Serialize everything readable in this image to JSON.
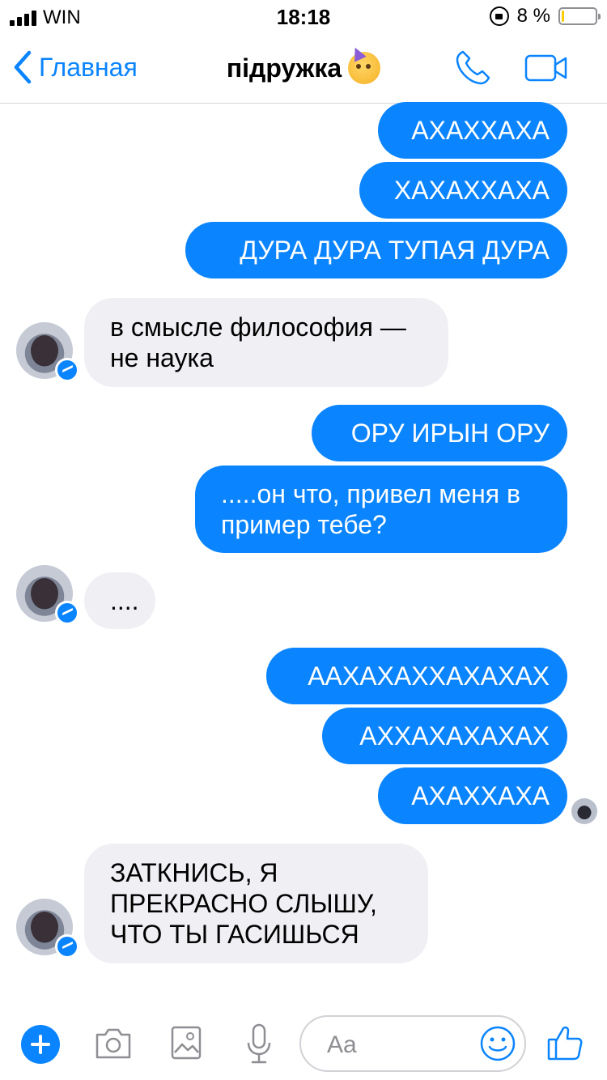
{
  "status_bar": {
    "carrier": "WIN",
    "time": "18:18",
    "battery_percent": "8 %",
    "battery_level": 0.08,
    "battery_color": "#ffcc00"
  },
  "nav": {
    "back_label": "Главная",
    "title": "підружка",
    "title_emoji": "partying-face-icon"
  },
  "messages": [
    {
      "side": "out",
      "text": "АХАХХАХА"
    },
    {
      "side": "out",
      "text": "ХАХАХХАХА"
    },
    {
      "side": "out",
      "text": "ДУРА ДУРА ТУПАЯ ДУРА"
    },
    {
      "side": "in",
      "text": "в смысле философия —\nне наука"
    },
    {
      "side": "out",
      "text": "ОРУ ИРЫН ОРУ"
    },
    {
      "side": "out",
      "text": ".....он что, привел меня в\nпример тебе?"
    },
    {
      "side": "in",
      "text": "...."
    },
    {
      "side": "out",
      "text": "ААХАХАХХАХАХАХ"
    },
    {
      "side": "out",
      "text": "АХХАХАХАХАХ"
    },
    {
      "side": "out",
      "text": "АХАХХАХА"
    },
    {
      "side": "in",
      "text": "ЗАТКНИСЬ, Я\nПРЕКРАСНО СЛЫШУ,\nЧТО ТЫ ГАСИШЬСЯ"
    }
  ],
  "composer": {
    "placeholder": "Aa"
  },
  "colors": {
    "accent": "#0a84ff",
    "incoming_bubble": "#f0eff4",
    "outgoing_bubble": "#0a84ff"
  }
}
